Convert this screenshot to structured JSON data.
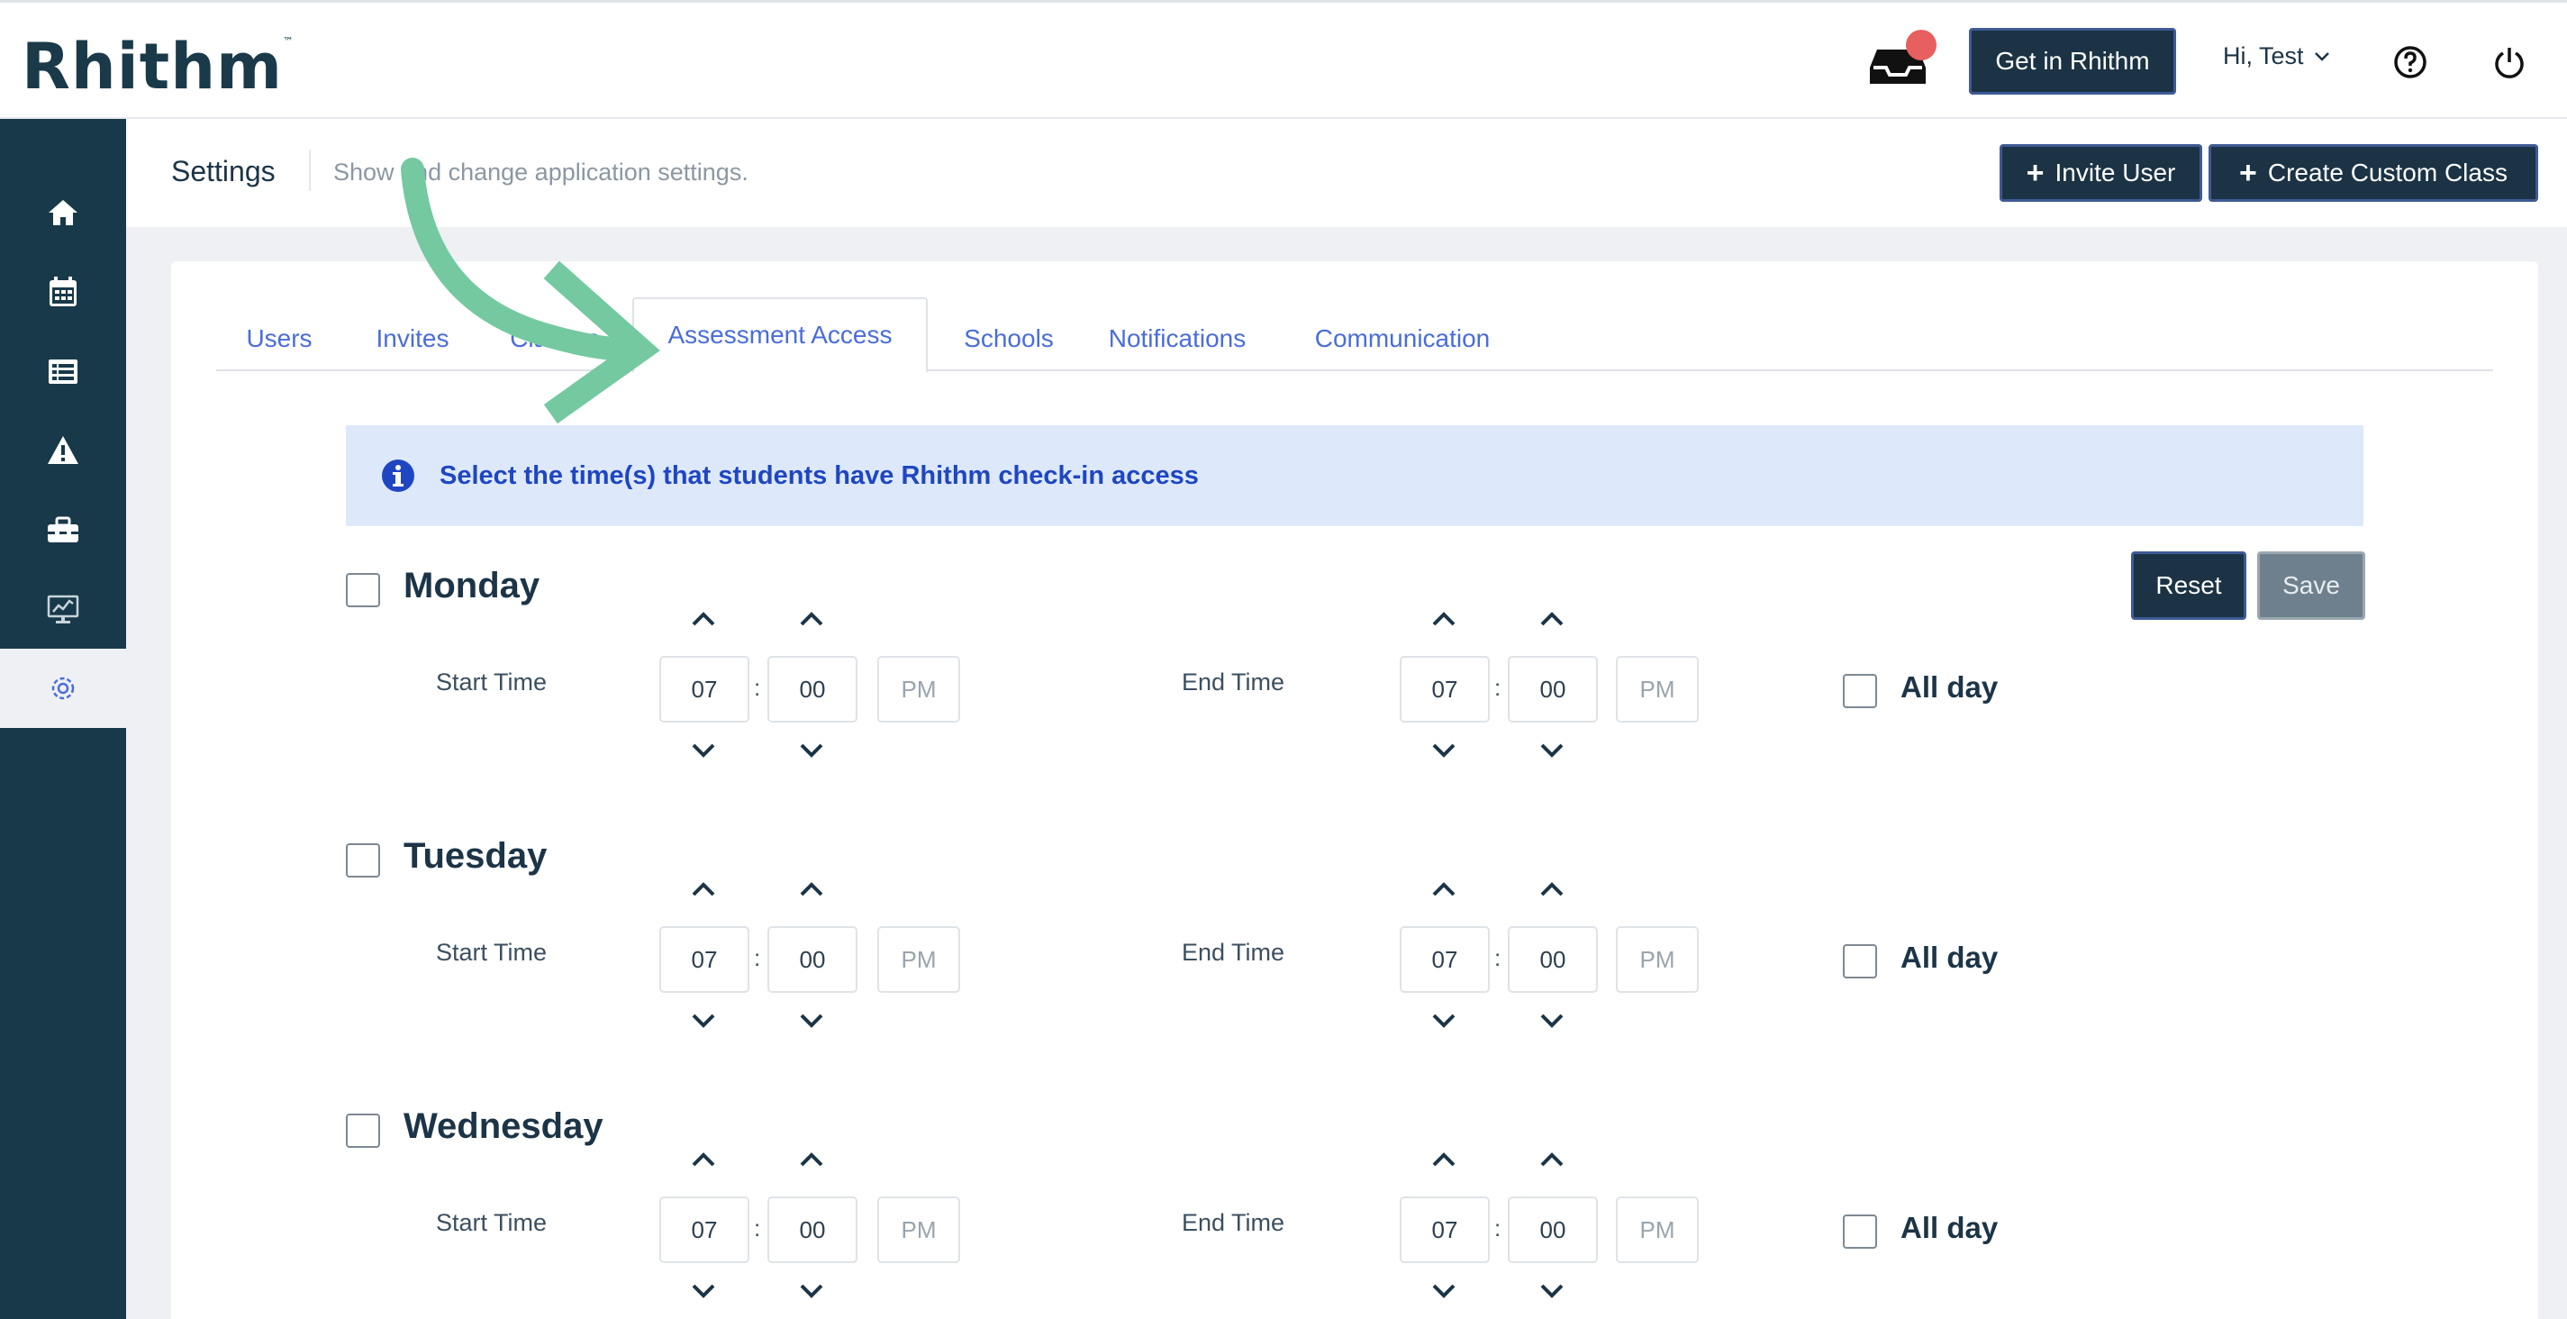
{
  "app": {
    "logo_text": "Rhithm",
    "logo_tm": "™",
    "get_rhithm_label": "Get in Rhithm",
    "user_greeting": "Hi, Test"
  },
  "sidebar": {
    "items": [
      {
        "icon": "home-icon"
      },
      {
        "icon": "calendar-icon"
      },
      {
        "icon": "list-icon"
      },
      {
        "icon": "warning-icon"
      },
      {
        "icon": "toolbox-icon"
      },
      {
        "icon": "monitor-chart-icon"
      },
      {
        "icon": "gear-icon",
        "active": true
      }
    ]
  },
  "settings": {
    "title": "Settings",
    "description": "Show and change application settings.",
    "invite_label": "Invite User",
    "create_class_label": "Create Custom Class"
  },
  "tabs": [
    {
      "label": "Users"
    },
    {
      "label": "Invites"
    },
    {
      "label": "Classes"
    },
    {
      "label": "Assessment Access",
      "active": true
    },
    {
      "label": "Schools"
    },
    {
      "label": "Notifications"
    },
    {
      "label": "Communication"
    }
  ],
  "info": {
    "text": "Select the time(s) that students have Rhithm check-in access"
  },
  "actions": {
    "reset_label": "Reset",
    "save_label": "Save"
  },
  "days": [
    {
      "name": "Monday",
      "start_label": "Start Time",
      "start_hour": "07",
      "start_min": "00",
      "start_ampm": "PM",
      "end_label": "End Time",
      "end_hour": "07",
      "end_min": "00",
      "end_ampm": "PM",
      "allday_label": "All day"
    },
    {
      "name": "Tuesday",
      "start_label": "Start Time",
      "start_hour": "07",
      "start_min": "00",
      "start_ampm": "PM",
      "end_label": "End Time",
      "end_hour": "07",
      "end_min": "00",
      "end_ampm": "PM",
      "allday_label": "All day"
    },
    {
      "name": "Wednesday",
      "start_label": "Start Time",
      "start_hour": "07",
      "start_min": "00",
      "start_ampm": "PM",
      "end_label": "End Time",
      "end_hour": "07",
      "end_min": "00",
      "end_ampm": "PM",
      "allday_label": "All day"
    }
  ],
  "colors": {
    "sidebar": "#18394a",
    "primary_dark": "#1b3344",
    "tab_link": "#4a6dd8",
    "info_bg": "#dde9fb",
    "info_text": "#1f46c2",
    "notification_dot": "#e85f5f",
    "annotation_arrow": "#74c9a0"
  }
}
